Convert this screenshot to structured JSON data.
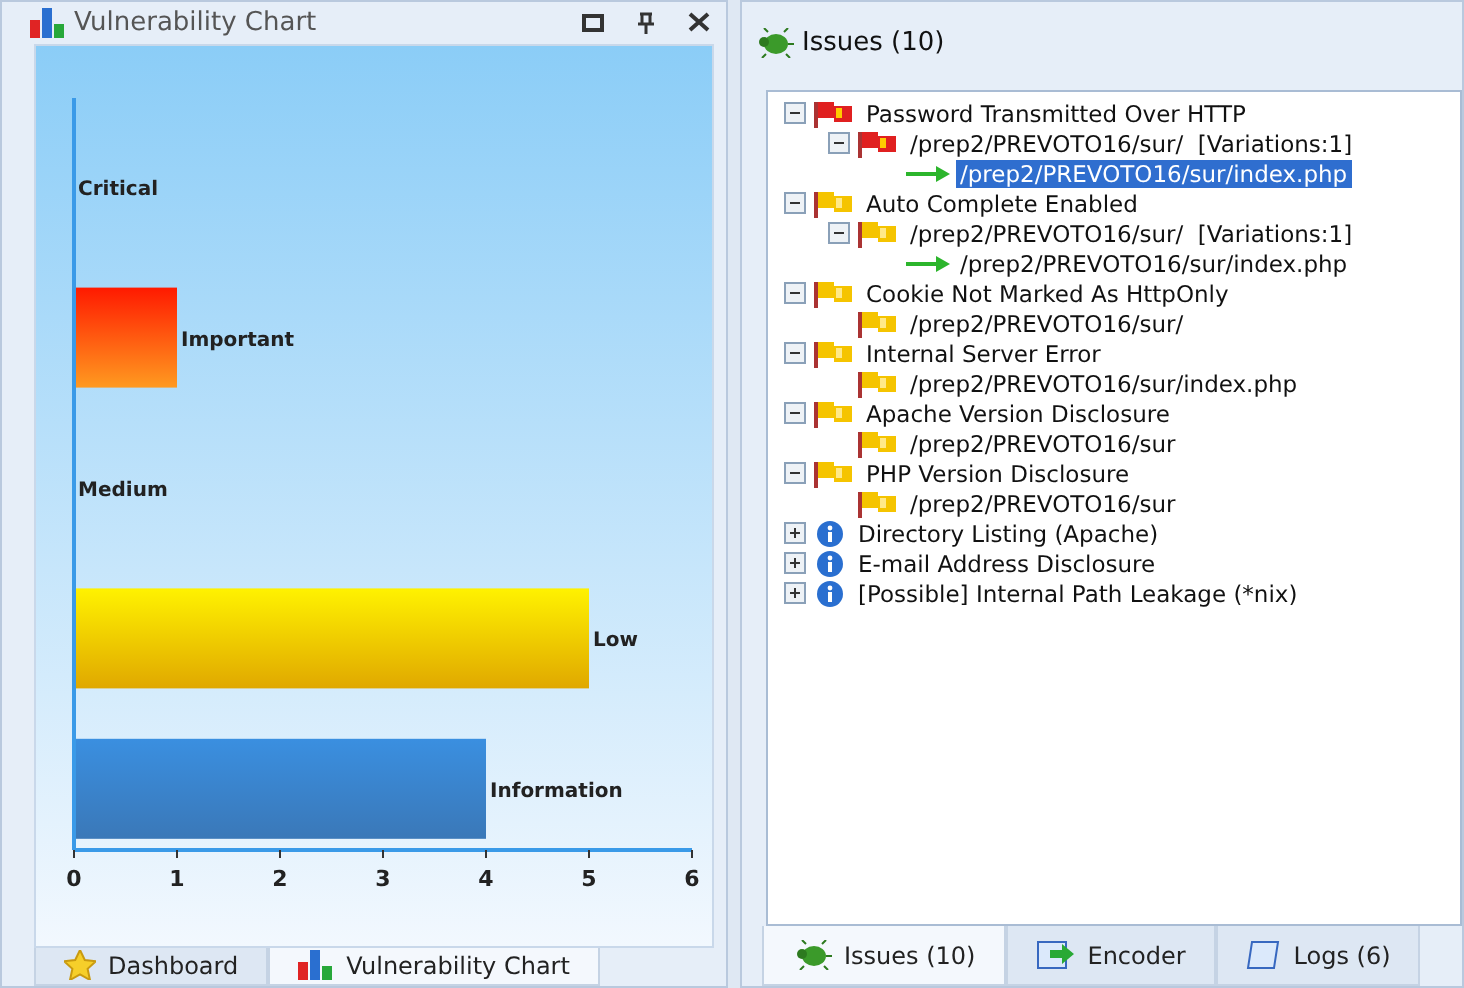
{
  "left_panel": {
    "title": "Vulnerability Chart",
    "chart_data": {
      "type": "bar",
      "orientation": "horizontal",
      "categories": [
        "Critical",
        "Important",
        "Medium",
        "Low",
        "Information"
      ],
      "values": [
        0,
        1,
        0,
        5,
        4
      ],
      "xlim": [
        0,
        6
      ],
      "xticks": [
        0,
        1,
        2,
        3,
        4,
        5,
        6
      ]
    },
    "tabs": [
      {
        "label": "Dashboard",
        "selected": false,
        "kind": "star"
      },
      {
        "label": "Vulnerability Chart",
        "selected": true,
        "kind": "chart"
      }
    ]
  },
  "right_panel": {
    "title": "Issues (10)",
    "tree": [
      {
        "label": "Password Transmitted Over HTTP",
        "kind": "high",
        "expanded": true,
        "selected": false,
        "children": [
          {
            "label": "/prep2/PREVOTO16/sur/  [Variations:1]",
            "kind": "high",
            "expanded": true,
            "selected": false,
            "children": [
              {
                "label": "/prep2/PREVOTO16/sur/index.php",
                "kind": "variation",
                "selected": true
              }
            ]
          }
        ]
      },
      {
        "label": "Auto Complete Enabled",
        "kind": "medium",
        "expanded": true,
        "selected": false,
        "children": [
          {
            "label": "/prep2/PREVOTO16/sur/  [Variations:1]",
            "kind": "medium",
            "expanded": true,
            "selected": false,
            "children": [
              {
                "label": "/prep2/PREVOTO16/sur/index.php",
                "kind": "variation",
                "selected": false
              }
            ]
          }
        ]
      },
      {
        "label": "Cookie Not Marked As HttpOnly",
        "kind": "medium",
        "expanded": true,
        "selected": false,
        "children": [
          {
            "label": "/prep2/PREVOTO16/sur/",
            "kind": "medium",
            "selected": false
          }
        ]
      },
      {
        "label": "Internal Server Error",
        "kind": "medium",
        "expanded": true,
        "selected": false,
        "children": [
          {
            "label": "/prep2/PREVOTO16/sur/index.php",
            "kind": "medium",
            "selected": false
          }
        ]
      },
      {
        "label": "Apache Version Disclosure",
        "kind": "medium",
        "expanded": true,
        "selected": false,
        "children": [
          {
            "label": "/prep2/PREVOTO16/sur",
            "kind": "medium",
            "selected": false
          }
        ]
      },
      {
        "label": "PHP Version Disclosure",
        "kind": "medium",
        "expanded": true,
        "selected": false,
        "children": [
          {
            "label": "/prep2/PREVOTO16/sur",
            "kind": "medium",
            "selected": false
          }
        ]
      },
      {
        "label": "Directory Listing (Apache)",
        "kind": "info",
        "expanded": false,
        "selected": false
      },
      {
        "label": "E-mail Address Disclosure",
        "kind": "info",
        "expanded": false,
        "selected": false
      },
      {
        "label": "[Possible] Internal Path Leakage (*nix)",
        "kind": "info",
        "expanded": false,
        "selected": false
      }
    ],
    "tabs": [
      {
        "label": "Issues (10)",
        "selected": true,
        "kind": "bug"
      },
      {
        "label": "Encoder",
        "selected": false,
        "kind": "encoder"
      },
      {
        "label": "Logs (6)",
        "selected": false,
        "kind": "log"
      }
    ]
  }
}
